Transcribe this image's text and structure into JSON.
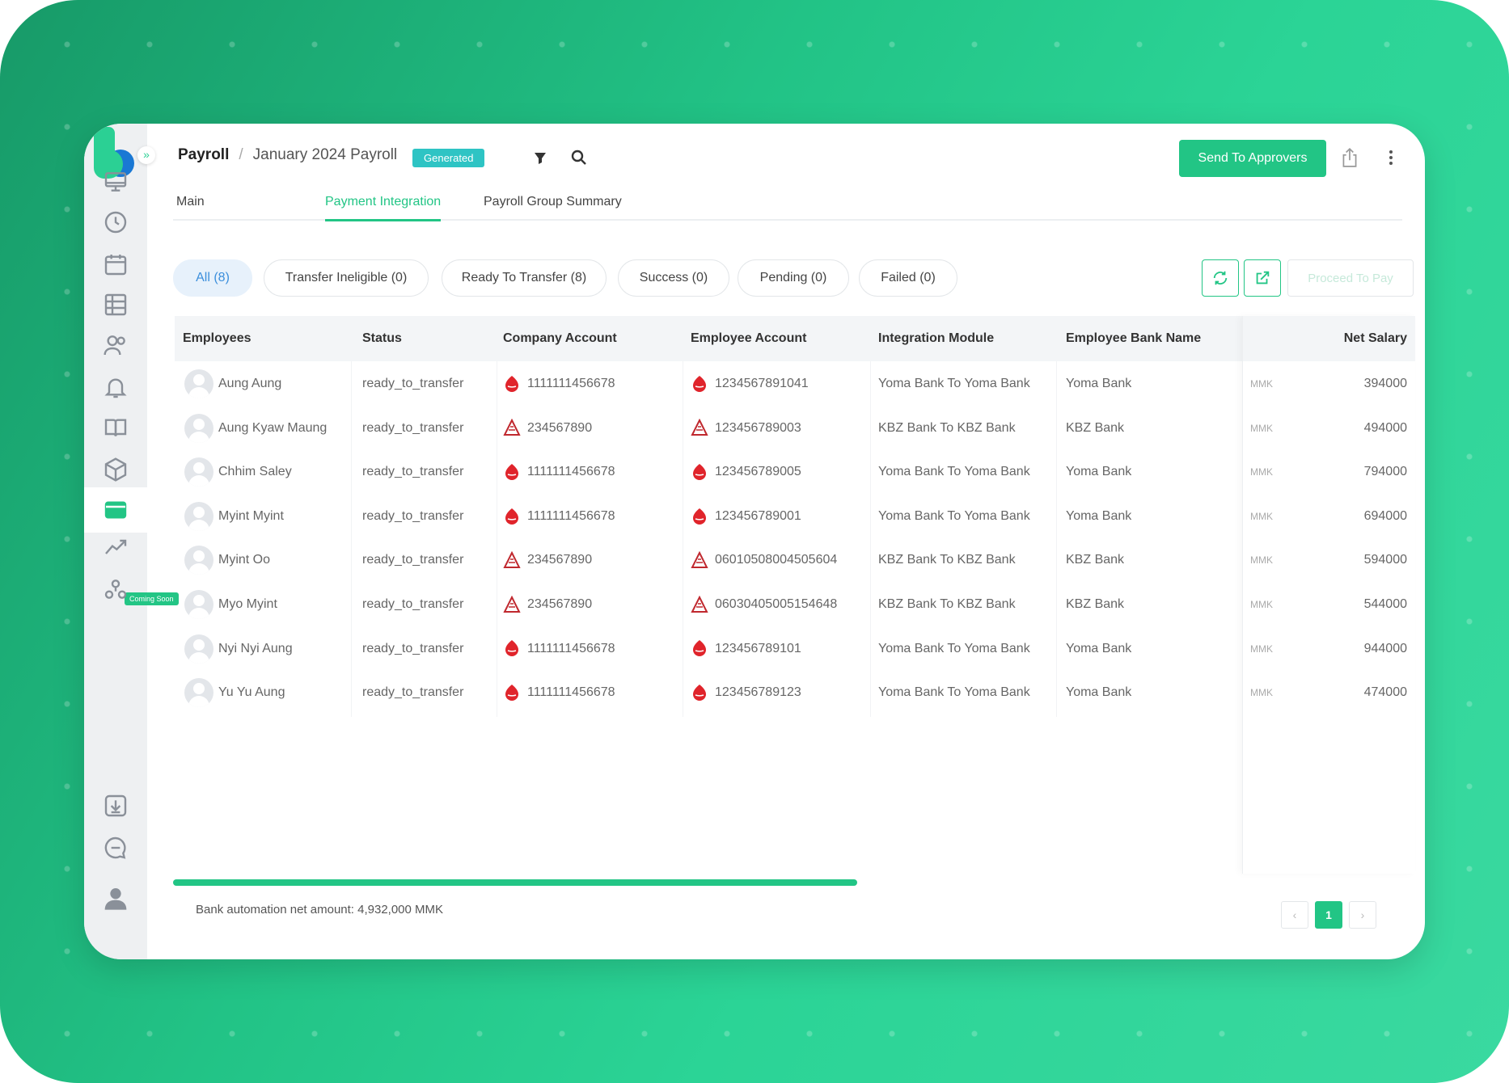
{
  "header": {
    "breadcrumb_root": "Payroll",
    "breadcrumb_sep": "/",
    "breadcrumb_current": "January 2024 Payroll",
    "status_badge": "Generated",
    "send_button": "Send To Approvers"
  },
  "sidebar": {
    "coming_soon": "Coming Soon",
    "items": [
      "monitor-icon",
      "clock-icon",
      "calendar-icon",
      "table-icon",
      "people-icon",
      "bell-icon",
      "book-icon",
      "box-icon",
      "wallet-icon",
      "analytics-icon",
      "users-network-icon"
    ],
    "active": "wallet-icon"
  },
  "tabs": [
    "Main",
    "Payment Integration",
    "Payroll Group Summary"
  ],
  "active_tab": "Payment Integration",
  "filters": [
    "All (8)",
    "Transfer Ineligible (0)",
    "Ready To Transfer (8)",
    "Success (0)",
    "Pending (0)",
    "Failed (0)"
  ],
  "proceed_button": "Proceed To Pay",
  "table": {
    "columns": [
      "Employees",
      "Status",
      "Company Account",
      "Employee Account",
      "Integration Module",
      "Employee Bank Name",
      "Net Salary"
    ],
    "rows": [
      {
        "name": "Aung Aung",
        "status": "ready_to_transfer",
        "company_account": "1111111456678",
        "company_bank": "yoma",
        "employee_account": "1234567891041",
        "employee_bank": "yoma",
        "module": "Yoma Bank To Yoma Bank",
        "bank_name": "Yoma Bank",
        "currency": "MMK",
        "salary": "394000"
      },
      {
        "name": "Aung Kyaw Maung",
        "status": "ready_to_transfer",
        "company_account": "234567890",
        "company_bank": "kbz",
        "employee_account": "123456789003",
        "employee_bank": "kbz",
        "module": "KBZ Bank To KBZ Bank",
        "bank_name": "KBZ Bank",
        "currency": "MMK",
        "salary": "494000"
      },
      {
        "name": "Chhim Saley",
        "status": "ready_to_transfer",
        "company_account": "1111111456678",
        "company_bank": "yoma",
        "employee_account": "123456789005",
        "employee_bank": "yoma",
        "module": "Yoma Bank To Yoma Bank",
        "bank_name": "Yoma Bank",
        "currency": "MMK",
        "salary": "794000"
      },
      {
        "name": "Myint Myint",
        "status": "ready_to_transfer",
        "company_account": "1111111456678",
        "company_bank": "yoma",
        "employee_account": "123456789001",
        "employee_bank": "yoma",
        "module": "Yoma Bank To Yoma Bank",
        "bank_name": "Yoma Bank",
        "currency": "MMK",
        "salary": "694000"
      },
      {
        "name": "Myint Oo",
        "status": "ready_to_transfer",
        "company_account": "234567890",
        "company_bank": "kbz",
        "employee_account": "06010508004505604",
        "employee_bank": "kbz",
        "module": "KBZ Bank To KBZ Bank",
        "bank_name": "KBZ Bank",
        "currency": "MMK",
        "salary": "594000"
      },
      {
        "name": "Myo Myint",
        "status": "ready_to_transfer",
        "company_account": "234567890",
        "company_bank": "kbz",
        "employee_account": "06030405005154648",
        "employee_bank": "kbz",
        "module": "KBZ Bank To KBZ Bank",
        "bank_name": "KBZ Bank",
        "currency": "MMK",
        "salary": "544000"
      },
      {
        "name": "Nyi Nyi Aung",
        "status": "ready_to_transfer",
        "company_account": "1111111456678",
        "company_bank": "yoma",
        "employee_account": "123456789101",
        "employee_bank": "yoma",
        "module": "Yoma Bank To Yoma Bank",
        "bank_name": "Yoma Bank",
        "currency": "MMK",
        "salary": "944000"
      },
      {
        "name": "Yu Yu Aung",
        "status": "ready_to_transfer",
        "company_account": "1111111456678",
        "company_bank": "yoma",
        "employee_account": "123456789123",
        "employee_bank": "yoma",
        "module": "Yoma Bank To Yoma Bank",
        "bank_name": "Yoma Bank",
        "currency": "MMK",
        "salary": "474000"
      }
    ]
  },
  "footer": {
    "net_amount": "Bank automation net amount: 4,932,000 MMK"
  },
  "pagination": {
    "prev": "‹",
    "current": "1",
    "next": "›"
  },
  "colors": {
    "accent": "#22c585",
    "yoma": "#e0242b",
    "kbz": "#c0282e",
    "badge": "#2ec4c4"
  }
}
